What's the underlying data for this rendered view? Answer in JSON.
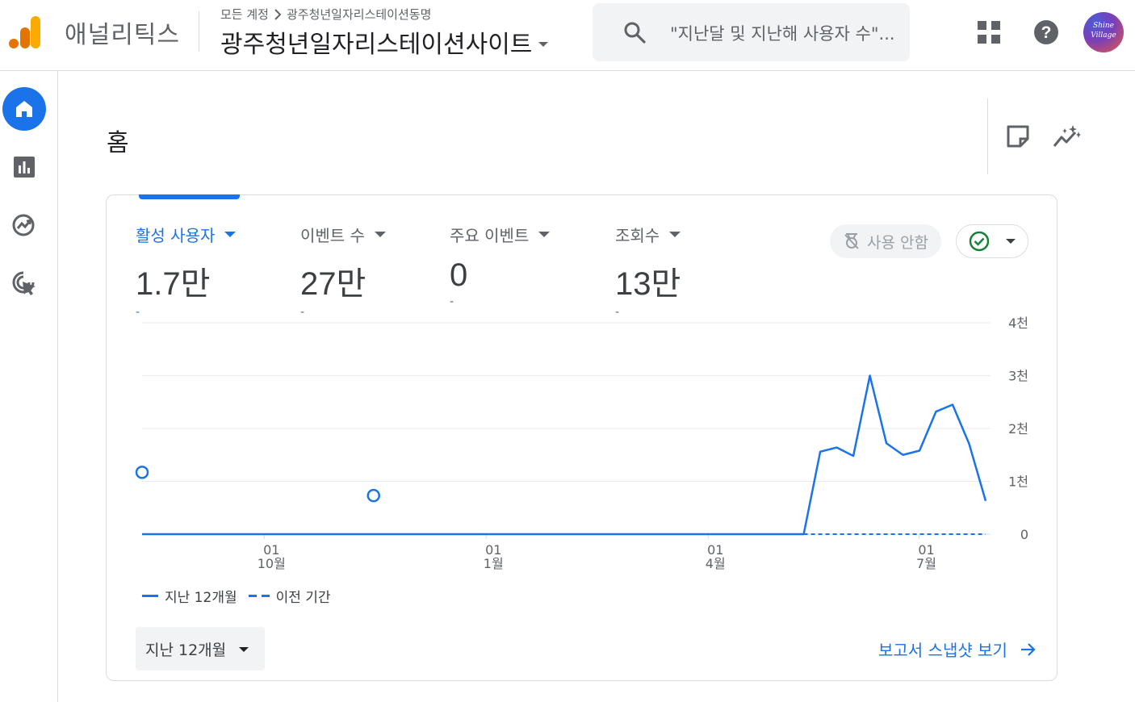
{
  "header": {
    "app_name": "애널리틱스",
    "breadcrumb_account": "모든 계정",
    "breadcrumb_property": "광주청년일자리스테이션동명",
    "property_name": "광주청년일자리스테이션사이트",
    "search_placeholder": "\"지난달 및 지난해 사용자 수\"...",
    "avatar_text_line1": "Shine",
    "avatar_text_line2": "Village"
  },
  "nav": {
    "items": [
      "home-icon",
      "reports-icon",
      "explore-icon",
      "advertising-icon"
    ],
    "active": "home"
  },
  "page": {
    "title": "홈"
  },
  "card": {
    "metrics": [
      {
        "label": "활성 사용자",
        "value": "1.7만",
        "delta": "-",
        "active": true
      },
      {
        "label": "이벤트 수",
        "value": "27만",
        "delta": "-",
        "active": false
      },
      {
        "label": "주요 이벤트",
        "value": "0",
        "delta": "-",
        "active": false
      },
      {
        "label": "조회수",
        "value": "13만",
        "delta": "-",
        "active": false
      }
    ],
    "sampling_label": "사용 안함",
    "status": "check-circle-icon",
    "legend_current": "지난 12개월",
    "legend_previous": "이전 기간",
    "period_select_value": "지난 12개월",
    "snapshot_link": "보고서 스냅샷 보기"
  },
  "colors": {
    "accent": "#1a73e8",
    "status_ok": "#188038",
    "text_secondary": "#5f6368"
  },
  "chart_data": {
    "type": "line",
    "ylim": [
      0,
      4000
    ],
    "y_ticks": [
      {
        "value": 0,
        "label": "0"
      },
      {
        "value": 1000,
        "label": "1천"
      },
      {
        "value": 2000,
        "label": "2천"
      },
      {
        "value": 3000,
        "label": "3천"
      },
      {
        "value": 4000,
        "label": "4천"
      }
    ],
    "x_ticks": [
      {
        "day": "01",
        "month": "10월"
      },
      {
        "day": "01",
        "month": "1월"
      },
      {
        "day": "01",
        "month": "4월"
      },
      {
        "day": "01",
        "month": "7월"
      }
    ],
    "series": [
      {
        "name": "지난 12개월",
        "style": "solid",
        "values": [
          0,
          0,
          0,
          0,
          0,
          0,
          0,
          0,
          0,
          0,
          0,
          0,
          0,
          0,
          0,
          0,
          0,
          0,
          0,
          0,
          0,
          0,
          0,
          0,
          0,
          0,
          0,
          0,
          0,
          0,
          0,
          0,
          0,
          0,
          0,
          0,
          0,
          0,
          0,
          0,
          0,
          1560,
          1640,
          1480,
          3000,
          1720,
          1500,
          1580,
          2320,
          2450,
          1710,
          630
        ]
      },
      {
        "name": "이전 기간",
        "style": "dashed",
        "isolated_points": [
          {
            "index": 0,
            "value": 1170
          },
          {
            "index": 8,
            "value": 730
          }
        ],
        "values_from_index": 40,
        "values": [
          0,
          0,
          0,
          0,
          0,
          0,
          0,
          0,
          0,
          0,
          0,
          0
        ]
      }
    ]
  }
}
